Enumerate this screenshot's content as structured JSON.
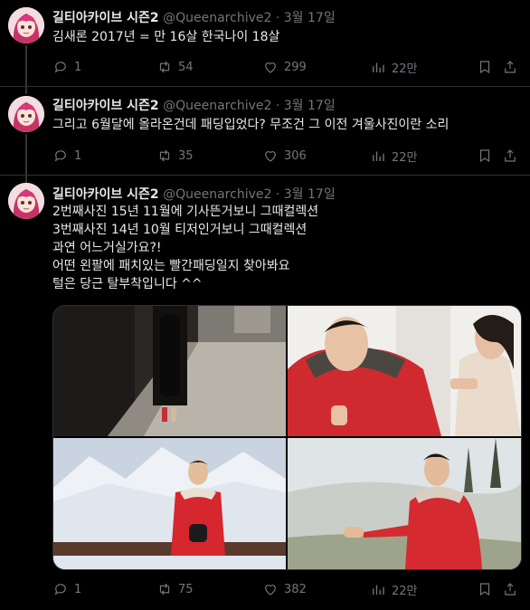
{
  "tweets": [
    {
      "author": "길티아카이브 시즌2",
      "handle": "@Queenarchive2",
      "date": "3월 17일",
      "lines": [
        "김새론 2017년 = 만 16살 한국나이 18살"
      ],
      "replies": "1",
      "retweets": "54",
      "likes": "299",
      "views": "22만"
    },
    {
      "author": "길티아카이브 시즌2",
      "handle": "@Queenarchive2",
      "date": "3월 17일",
      "lines": [
        "그리고 6월달에 올라온건데 패딩입었다? 무조건 그 이전 겨울사진이란 소리"
      ],
      "replies": "1",
      "retweets": "35",
      "likes": "306",
      "views": "22만"
    },
    {
      "author": "길티아카이브 시즌2",
      "handle": "@Queenarchive2",
      "date": "3월 17일",
      "lines": [
        "2번째사진 15년 11월에 기사뜬거보니 그때컬렉션",
        "3번째사진 14년 10월 티저인거보니 그때컬렉션",
        "과연 어느거실가요?!",
        "어떤 왼팔에 패치있는 빨간패딩일지 찾아봐요",
        "털은 당근 탈부착입니다 ^^"
      ],
      "replies": "1",
      "retweets": "75",
      "likes": "382",
      "views": "22만"
    }
  ],
  "separator": "·",
  "colors": {
    "background": "#000000",
    "text": "#e7e9ea",
    "muted": "#71767b",
    "border": "#2f3336",
    "jacket": "#d62b32"
  },
  "icons": [
    "reply-icon",
    "retweet-icon",
    "like-icon",
    "views-icon",
    "bookmark-icon",
    "share-icon"
  ]
}
